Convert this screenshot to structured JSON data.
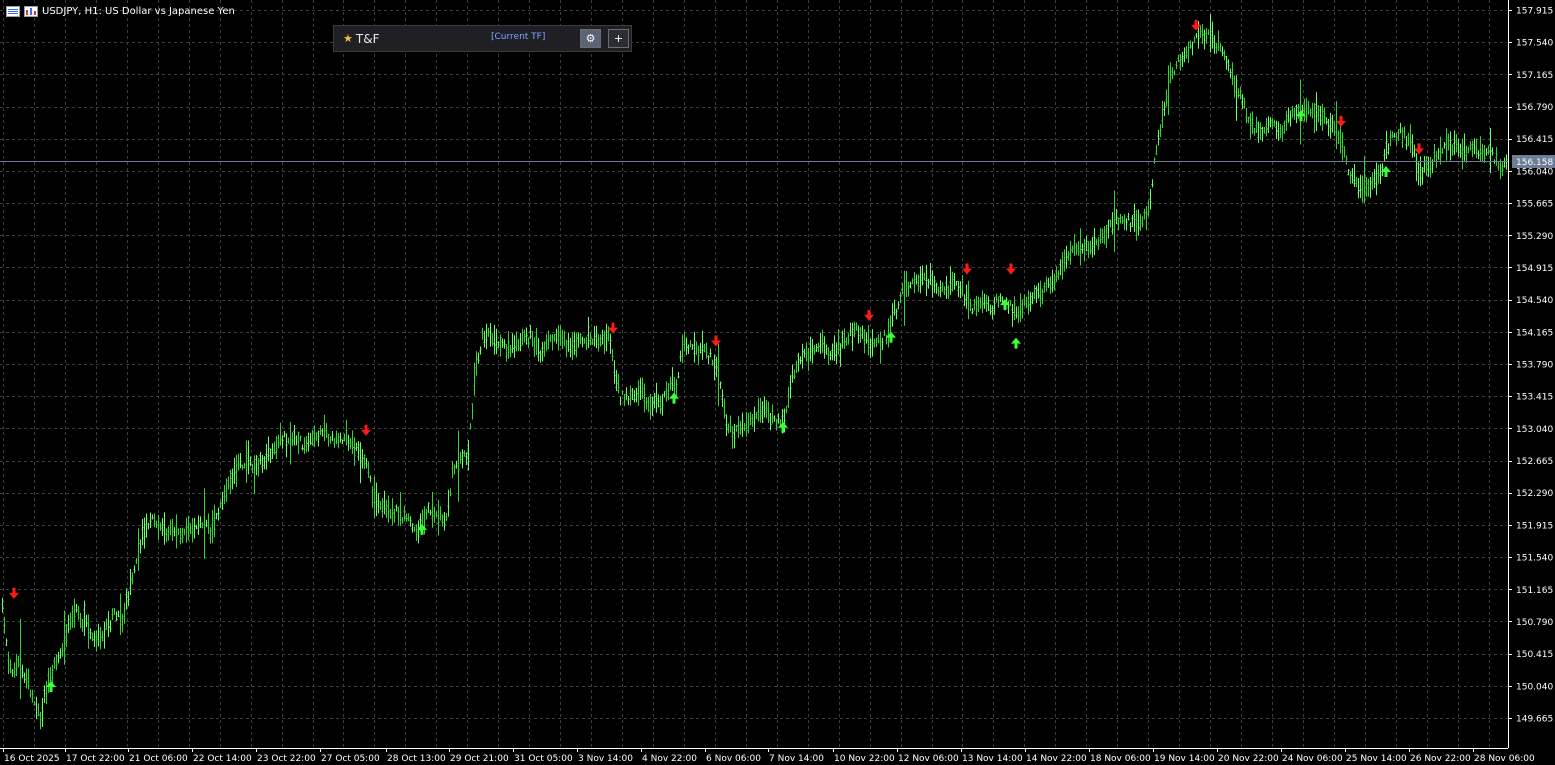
{
  "window": {
    "symbol_title": "USDJPY, H1: US Dollar vs Japanese Yen"
  },
  "panel": {
    "title": "T&F",
    "star_icon": "★",
    "timeframe_label": "[Current TF]",
    "settings_icon": "⚙",
    "add_icon": "+"
  },
  "colors": {
    "background": "#000000",
    "grid": "#3c3c3c",
    "bars": "#32d332",
    "bars_bright": "#66ff66",
    "buy_arrow": "#3cff3c",
    "sell_arrow": "#ff1a1a",
    "current_price_line": "#6e7d96",
    "current_price_label_bg": "#6e7d96",
    "axis_text": "#ffffff"
  },
  "chart_data": {
    "type": "bar",
    "symbol": "USDJPY",
    "timeframe": "H1",
    "current_price": "156.158",
    "y_ticks": [
      "157.915",
      "157.540",
      "157.165",
      "156.790",
      "156.415",
      "156.040",
      "155.665",
      "155.290",
      "154.915",
      "154.540",
      "154.165",
      "153.790",
      "153.415",
      "153.040",
      "152.665",
      "152.290",
      "151.915",
      "151.540",
      "151.165",
      "150.790",
      "150.415",
      "150.040",
      "149.665"
    ],
    "ylim": [
      149.37,
      158.0
    ],
    "x_ticks": [
      "16 Oct 2025",
      "17 Oct 22:00",
      "21 Oct 06:00",
      "22 Oct 14:00",
      "23 Oct 22:00",
      "27 Oct 05:00",
      "28 Oct 13:00",
      "29 Oct 21:00",
      "31 Oct 05:00",
      "3 Nov 14:00",
      "4 Nov 22:00",
      "6 Nov 06:00",
      "7 Nov 14:00",
      "10 Nov 22:00",
      "12 Nov 06:00",
      "13 Nov 14:00",
      "14 Nov 22:00",
      "18 Nov 06:00",
      "19 Nov 14:00",
      "20 Nov 22:00",
      "24 Nov 06:00",
      "25 Nov 14:00",
      "26 Nov 22:00",
      "28 Nov 06:00"
    ],
    "price_path": [
      [
        0,
        151.25
      ],
      [
        5,
        150.6
      ],
      [
        10,
        150.2
      ],
      [
        20,
        150.3
      ],
      [
        30,
        150.0
      ],
      [
        40,
        149.7
      ],
      [
        48,
        150.1
      ],
      [
        55,
        150.3
      ],
      [
        65,
        150.6
      ],
      [
        75,
        150.9
      ],
      [
        85,
        150.8
      ],
      [
        95,
        150.6
      ],
      [
        105,
        150.7
      ],
      [
        115,
        150.9
      ],
      [
        122,
        150.8
      ],
      [
        128,
        151.1
      ],
      [
        135,
        151.5
      ],
      [
        142,
        151.8
      ],
      [
        150,
        152.0
      ],
      [
        160,
        151.9
      ],
      [
        170,
        151.85
      ],
      [
        180,
        151.8
      ],
      [
        190,
        151.85
      ],
      [
        200,
        151.9
      ],
      [
        210,
        151.85
      ],
      [
        218,
        152.0
      ],
      [
        225,
        152.3
      ],
      [
        235,
        152.55
      ],
      [
        245,
        152.65
      ],
      [
        255,
        152.6
      ],
      [
        265,
        152.7
      ],
      [
        275,
        152.85
      ],
      [
        285,
        152.95
      ],
      [
        295,
        152.9
      ],
      [
        305,
        152.85
      ],
      [
        315,
        152.95
      ],
      [
        325,
        153.0
      ],
      [
        335,
        152.9
      ],
      [
        345,
        152.95
      ],
      [
        355,
        152.8
      ],
      [
        365,
        152.7
      ],
      [
        372,
        152.3
      ],
      [
        380,
        152.1
      ],
      [
        390,
        152.1
      ],
      [
        400,
        152.05
      ],
      [
        410,
        151.95
      ],
      [
        418,
        151.85
      ],
      [
        428,
        152.15
      ],
      [
        435,
        152.05
      ],
      [
        445,
        151.95
      ],
      [
        452,
        152.5
      ],
      [
        460,
        152.65
      ],
      [
        468,
        152.8
      ],
      [
        475,
        153.7
      ],
      [
        482,
        154.1
      ],
      [
        490,
        154.1
      ],
      [
        500,
        154.0
      ],
      [
        510,
        153.95
      ],
      [
        520,
        154.05
      ],
      [
        530,
        154.1
      ],
      [
        540,
        153.95
      ],
      [
        550,
        154.05
      ],
      [
        560,
        154.1
      ],
      [
        570,
        154.0
      ],
      [
        580,
        154.1
      ],
      [
        590,
        154.1
      ],
      [
        600,
        154.05
      ],
      [
        608,
        154.15
      ],
      [
        615,
        153.65
      ],
      [
        620,
        153.4
      ],
      [
        630,
        153.4
      ],
      [
        640,
        153.5
      ],
      [
        650,
        153.3
      ],
      [
        660,
        153.35
      ],
      [
        670,
        153.5
      ],
      [
        676,
        153.55
      ],
      [
        682,
        154.0
      ],
      [
        690,
        154.0
      ],
      [
        700,
        153.95
      ],
      [
        710,
        153.9
      ],
      [
        718,
        153.7
      ],
      [
        726,
        153.1
      ],
      [
        735,
        153.0
      ],
      [
        745,
        153.05
      ],
      [
        755,
        153.2
      ],
      [
        765,
        153.25
      ],
      [
        775,
        153.1
      ],
      [
        785,
        153.2
      ],
      [
        792,
        153.6
      ],
      [
        800,
        153.85
      ],
      [
        810,
        153.95
      ],
      [
        820,
        154.05
      ],
      [
        830,
        153.95
      ],
      [
        840,
        154.0
      ],
      [
        850,
        154.15
      ],
      [
        860,
        154.2
      ],
      [
        870,
        154.0
      ],
      [
        880,
        154.05
      ],
      [
        888,
        154.15
      ],
      [
        895,
        154.4
      ],
      [
        905,
        154.7
      ],
      [
        915,
        154.8
      ],
      [
        925,
        154.8
      ],
      [
        935,
        154.7
      ],
      [
        945,
        154.65
      ],
      [
        955,
        154.75
      ],
      [
        965,
        154.55
      ],
      [
        972,
        154.45
      ],
      [
        980,
        154.5
      ],
      [
        990,
        154.45
      ],
      [
        1000,
        154.55
      ],
      [
        1008,
        154.5
      ],
      [
        1016,
        154.35
      ],
      [
        1024,
        154.5
      ],
      [
        1032,
        154.6
      ],
      [
        1042,
        154.65
      ],
      [
        1052,
        154.75
      ],
      [
        1060,
        154.9
      ],
      [
        1070,
        155.1
      ],
      [
        1080,
        155.2
      ],
      [
        1090,
        155.1
      ],
      [
        1100,
        155.25
      ],
      [
        1110,
        155.4
      ],
      [
        1120,
        155.5
      ],
      [
        1130,
        155.45
      ],
      [
        1140,
        155.4
      ],
      [
        1148,
        155.6
      ],
      [
        1155,
        156.2
      ],
      [
        1162,
        156.7
      ],
      [
        1170,
        157.1
      ],
      [
        1180,
        157.35
      ],
      [
        1190,
        157.5
      ],
      [
        1200,
        157.6
      ],
      [
        1210,
        157.65
      ],
      [
        1220,
        157.45
      ],
      [
        1230,
        157.2
      ],
      [
        1240,
        156.9
      ],
      [
        1250,
        156.6
      ],
      [
        1260,
        156.5
      ],
      [
        1270,
        156.6
      ],
      [
        1280,
        156.45
      ],
      [
        1290,
        156.7
      ],
      [
        1300,
        156.8
      ],
      [
        1310,
        156.75
      ],
      [
        1320,
        156.65
      ],
      [
        1330,
        156.6
      ],
      [
        1340,
        156.4
      ],
      [
        1350,
        156.0
      ],
      [
        1360,
        155.85
      ],
      [
        1370,
        155.9
      ],
      [
        1380,
        156.05
      ],
      [
        1390,
        156.4
      ],
      [
        1400,
        156.5
      ],
      [
        1410,
        156.35
      ],
      [
        1420,
        156.0
      ],
      [
        1430,
        156.1
      ],
      [
        1440,
        156.3
      ],
      [
        1450,
        156.35
      ],
      [
        1460,
        156.3
      ],
      [
        1470,
        156.3
      ],
      [
        1480,
        156.25
      ],
      [
        1490,
        156.25
      ],
      [
        1500,
        156.1
      ],
      [
        1507,
        156.1
      ]
    ],
    "signals": [
      {
        "type": "sell",
        "bar": 14,
        "price": 151.1
      },
      {
        "type": "buy",
        "bar": 51,
        "price": 150.05
      },
      {
        "type": "sell",
        "bar": 366,
        "price": 153.0
      },
      {
        "type": "buy",
        "bar": 422,
        "price": 151.88
      },
      {
        "type": "sell",
        "bar": 613,
        "price": 154.19
      },
      {
        "type": "buy",
        "bar": 674,
        "price": 153.41
      },
      {
        "type": "sell",
        "bar": 716,
        "price": 154.04
      },
      {
        "type": "buy",
        "bar": 783,
        "price": 153.07
      },
      {
        "type": "sell",
        "bar": 869,
        "price": 154.34
      },
      {
        "type": "buy",
        "bar": 891,
        "price": 154.12
      },
      {
        "type": "sell",
        "bar": 967,
        "price": 154.88
      },
      {
        "type": "sell",
        "bar": 1011,
        "price": 154.88
      },
      {
        "type": "buy",
        "bar": 1005,
        "price": 154.5
      },
      {
        "type": "buy",
        "bar": 1016,
        "price": 154.05
      },
      {
        "type": "sell",
        "bar": 1196,
        "price": 157.72
      },
      {
        "type": "buy",
        "bar": 1301,
        "price": 156.7
      },
      {
        "type": "sell",
        "bar": 1341,
        "price": 156.6
      },
      {
        "type": "buy",
        "bar": 1386,
        "price": 156.05
      },
      {
        "type": "sell",
        "bar": 1419,
        "price": 156.28
      }
    ]
  }
}
